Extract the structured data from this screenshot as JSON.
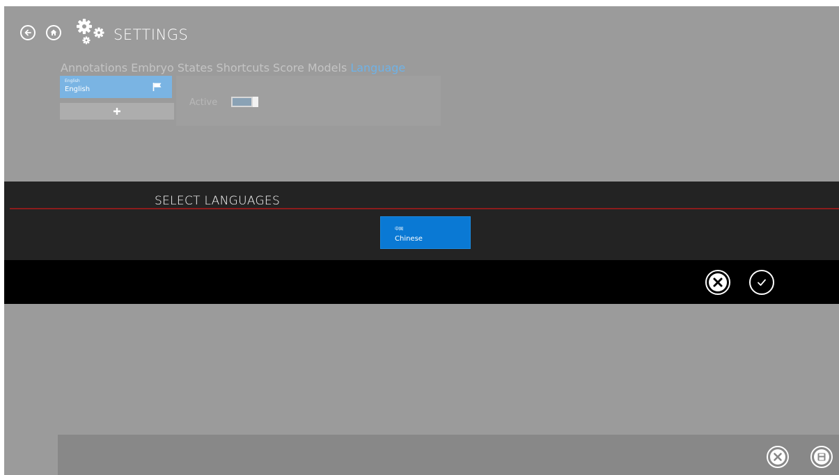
{
  "header": {
    "title": "SETTINGS",
    "back_icon": "arrow-left-circle-icon",
    "home_icon": "home-circle-icon",
    "settings_icon": "gears-icon"
  },
  "tabs": [
    {
      "label": "Annotations",
      "active": false
    },
    {
      "label": "Embryo States",
      "active": false
    },
    {
      "label": "Shortcuts",
      "active": false
    },
    {
      "label": "Score Models",
      "active": false
    },
    {
      "label": "Language",
      "active": true
    }
  ],
  "languages_list": {
    "items": [
      {
        "native": "English",
        "name": "English",
        "icon": "flag-icon"
      }
    ],
    "add_icon": "plus-icon"
  },
  "detail": {
    "active_label": "Active",
    "active_toggle": true
  },
  "dialog": {
    "title": "SELECT LANGUAGES",
    "options": [
      {
        "native": "中国",
        "name": "Chinese",
        "selected": true
      }
    ],
    "cancel_icon": "close-circle-icon",
    "confirm_icon": "check-circle-icon"
  },
  "footer": {
    "cancel_icon": "close-circle-icon",
    "save_icon": "save-disk-icon"
  },
  "colors": {
    "background": "#9b9b9b",
    "accent": "#0a79d4",
    "tab_active": "#6fb2e6",
    "dialog_line": "#8c1c1c",
    "dialog_bg": "#232323"
  }
}
